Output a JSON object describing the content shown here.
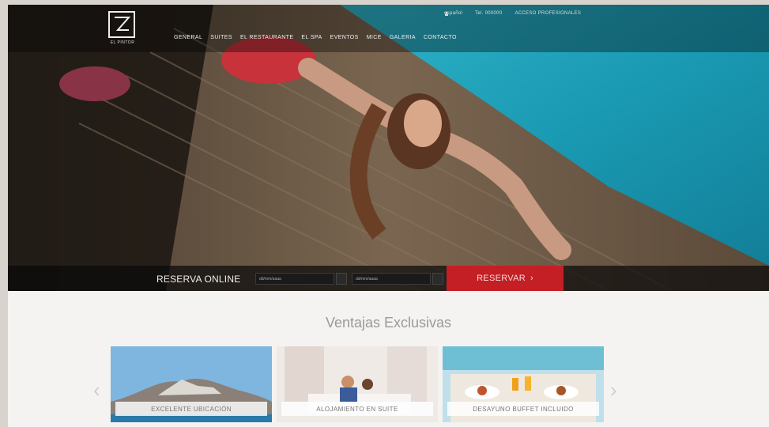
{
  "header": {
    "logo_text": "EL PINTOR",
    "nav": [
      "GENERAL",
      "SUITES",
      "EL RESTAURANTE",
      "EL SPA",
      "EVENTOS",
      "MICE",
      "GALERIA",
      "CONTACTO"
    ],
    "util": [
      "español",
      "Tel. 000000",
      "ACCESO PROFESIONALES"
    ]
  },
  "booking": {
    "label": "RESERVA ONLINE",
    "checkin_placeholder": "dd/mm/aaaa",
    "checkout_placeholder": "dd/mm/aaaa",
    "button_label": "RESERVAR"
  },
  "section": {
    "title": "Ventajas Exclusivas",
    "cards": [
      {
        "label": "EXCELENTE UBICACIÓN"
      },
      {
        "label": "ALOJAMIENTO EN SUITE"
      },
      {
        "label": "DESAYUNO BUFFET INCLUIDO"
      }
    ]
  },
  "arrows": {
    "prev": "‹",
    "next": "›"
  }
}
